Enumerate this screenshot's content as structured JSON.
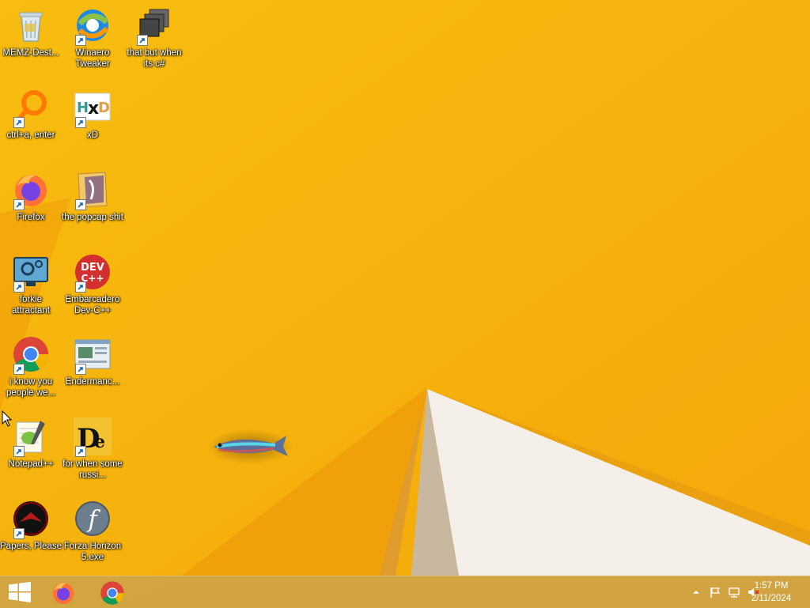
{
  "desktop": {
    "icons": [
      {
        "label": "MEMZ-Dest...",
        "icon": "recycle-bin-icon"
      },
      {
        "label": "Winaero Tweaker",
        "icon": "winaero-tweaker-icon"
      },
      {
        "label": "that but when its c#",
        "icon": "stacked-windows-icon"
      },
      {
        "label": "ctrl+a, enter",
        "icon": "magnifier-ring-icon"
      },
      {
        "label": "xD",
        "icon": "hxd-icon"
      },
      {
        "label": "Firefox",
        "icon": "firefox-icon"
      },
      {
        "label": "the popcap shit",
        "icon": "folder-icon"
      },
      {
        "label": "forkie attractant",
        "icon": "settings-monitor-icon"
      },
      {
        "label": "Embarcadero Dev-C++",
        "icon": "devcpp-icon"
      },
      {
        "label": "i know you people we...",
        "icon": "chrome-icon"
      },
      {
        "label": "Endermanc...",
        "icon": "window-app-icon"
      },
      {
        "label": "Notepad++",
        "icon": "notepadpp-icon"
      },
      {
        "label": "for when some russi...",
        "icon": "de-icon"
      },
      {
        "label": "Papers, Please",
        "icon": "papers-please-icon"
      },
      {
        "label": "Forza Horizon 5.exe",
        "icon": "flash-icon"
      }
    ],
    "overlay": "fish-icon"
  },
  "taskbar": {
    "pinned": [
      "firefox-icon",
      "chrome-icon"
    ],
    "tray": [
      "show-hidden-icons-chevron-icon",
      "action-center-flag-icon",
      "network-icon",
      "volume-muted-icon"
    ],
    "clock": {
      "time": "1:57 PM",
      "date": "2/11/2024"
    }
  },
  "colors": {
    "wallpaper": "#f5ae0a",
    "taskbar": "#cea446",
    "label_text": "#ffffff"
  }
}
